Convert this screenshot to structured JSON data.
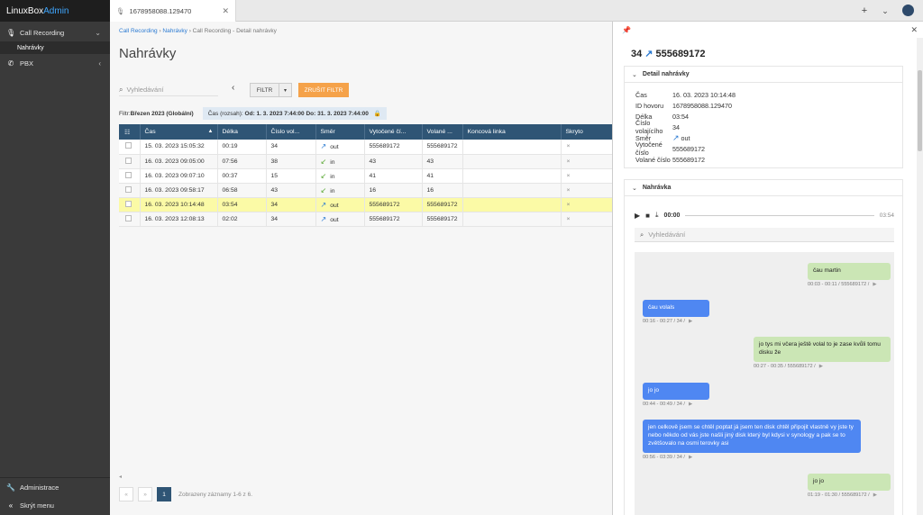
{
  "app": {
    "brand_a": "LinuxBox",
    "brand_b": "Admin"
  },
  "sidebar": {
    "items": [
      {
        "label": "Call Recording",
        "icon": "microphone-icon"
      },
      {
        "label": "PBX",
        "icon": "phone-icon"
      }
    ],
    "sub_items": [
      {
        "label": "Nahrávky"
      }
    ],
    "bottom": [
      {
        "label": "Administrace",
        "icon": "wrench-icon"
      },
      {
        "label": "Skrýt menu",
        "icon": "chevron-left-double-icon"
      }
    ]
  },
  "topbar": {
    "tab_label": "1678958088.129470"
  },
  "main": {
    "breadcrumb": {
      "a": "Call Recording",
      "sep1": " › ",
      "b": "Nahrávky",
      "c": " › Call Recording - Detail nahrávky"
    },
    "title": "Nahrávky",
    "search_placeholder": "Vyhledávání",
    "filter_label": "FILTR",
    "cancel_filter_label": "ZRUŠIT FILTR",
    "filter_prefix": "Filtr: ",
    "filter_value": "Březen 2023 (Globální)",
    "range_prefix": "Čas (rozsah): ",
    "range_value": "Od: 1. 3. 2023 7:44:00 Do: 31. 3. 2023 7:44:00",
    "pager_text": "Zobrazeny záznamy 1-6 z 6.",
    "pager_page": "1"
  },
  "table": {
    "columns": [
      "Čas",
      "Délka",
      "Číslo vol...",
      "Směr",
      "Vytočené čí...",
      "Volané ...",
      "Koncová linka",
      "Skryto"
    ],
    "rows": [
      {
        "time": "15. 03. 2023 15:05:32",
        "len": "00:19",
        "caller": "34",
        "dir": "out",
        "dialed": "555689172",
        "called": "555689172",
        "line": "",
        "hidden": "×"
      },
      {
        "time": "16. 03. 2023 09:05:00",
        "len": "07:56",
        "caller": "38",
        "dir": "in",
        "dialed": "43",
        "called": "43",
        "line": "",
        "hidden": "×"
      },
      {
        "time": "16. 03. 2023 09:07:10",
        "len": "00:37",
        "caller": "15",
        "dir": "in",
        "dialed": "41",
        "called": "41",
        "line": "",
        "hidden": "×"
      },
      {
        "time": "16. 03. 2023 09:58:17",
        "len": "06:58",
        "caller": "43",
        "dir": "in",
        "dialed": "16",
        "called": "16",
        "line": "",
        "hidden": "×"
      },
      {
        "time": "16. 03. 2023 10:14:48",
        "len": "03:54",
        "caller": "34",
        "dir": "out",
        "dialed": "555689172",
        "called": "555689172",
        "line": "",
        "hidden": "×"
      },
      {
        "time": "16. 03. 2023 12:08:13",
        "len": "02:02",
        "caller": "34",
        "dir": "out",
        "dialed": "555689172",
        "called": "555689172",
        "line": "",
        "hidden": "×"
      }
    ]
  },
  "panel": {
    "title_from": "34",
    "title_to": "555689172",
    "detail_header": "Detail nahrávky",
    "details": [
      {
        "k": "Čas",
        "v": "16. 03. 2023 10:14:48"
      },
      {
        "k": "ID hovoru",
        "v": "1678958088.129470"
      },
      {
        "k": "Délka",
        "v": "03:54"
      },
      {
        "k": "Číslo volajícího",
        "v": "34"
      },
      {
        "k": "Směr",
        "v": "out"
      },
      {
        "k": "Vytočené číslo",
        "v": "555689172"
      },
      {
        "k": "Volané číslo",
        "v": "555689172"
      }
    ],
    "recording_header": "Nahrávka",
    "player": {
      "current": "00:00",
      "total": "03:54"
    },
    "search_placeholder": "Vyhledávání",
    "messages": [
      {
        "side": "r",
        "text": "čau martin",
        "meta": "00:03 - 00:11 / 555689172 /"
      },
      {
        "side": "l",
        "text": "čau volals",
        "meta": "00:16 - 00:27 / 34 /"
      },
      {
        "side": "r",
        "text": "jo tys mi včera ještě volal to je zase kvůli tomu disku že",
        "meta": "00:27 - 00:35 / 555689172 /"
      },
      {
        "side": "l",
        "text": "jo jo",
        "meta": "00:44 - 00:49 / 34 /"
      },
      {
        "side": "l",
        "text": "jen celkově jsem se chtěl poptat já jsem ten disk chtěl připojit vlastně vy jste ty nebo někdo od vás jste našli jiný disk který byl kdysi v synology a pak se to zvětšovalo na osmi terovky asi",
        "meta": "00:56 - 03:39 / 34 /"
      },
      {
        "side": "r",
        "text": "jo jo",
        "meta": "01:19 - 01:30 / 555689172 /"
      }
    ]
  },
  "colors": {
    "accent": "#2a7ad2",
    "header": "#2f5575",
    "orange": "#f5a24a",
    "selected_row": "#fbfaa6",
    "bubble_left": "#4f87f2",
    "bubble_right": "#cbe6b5"
  }
}
